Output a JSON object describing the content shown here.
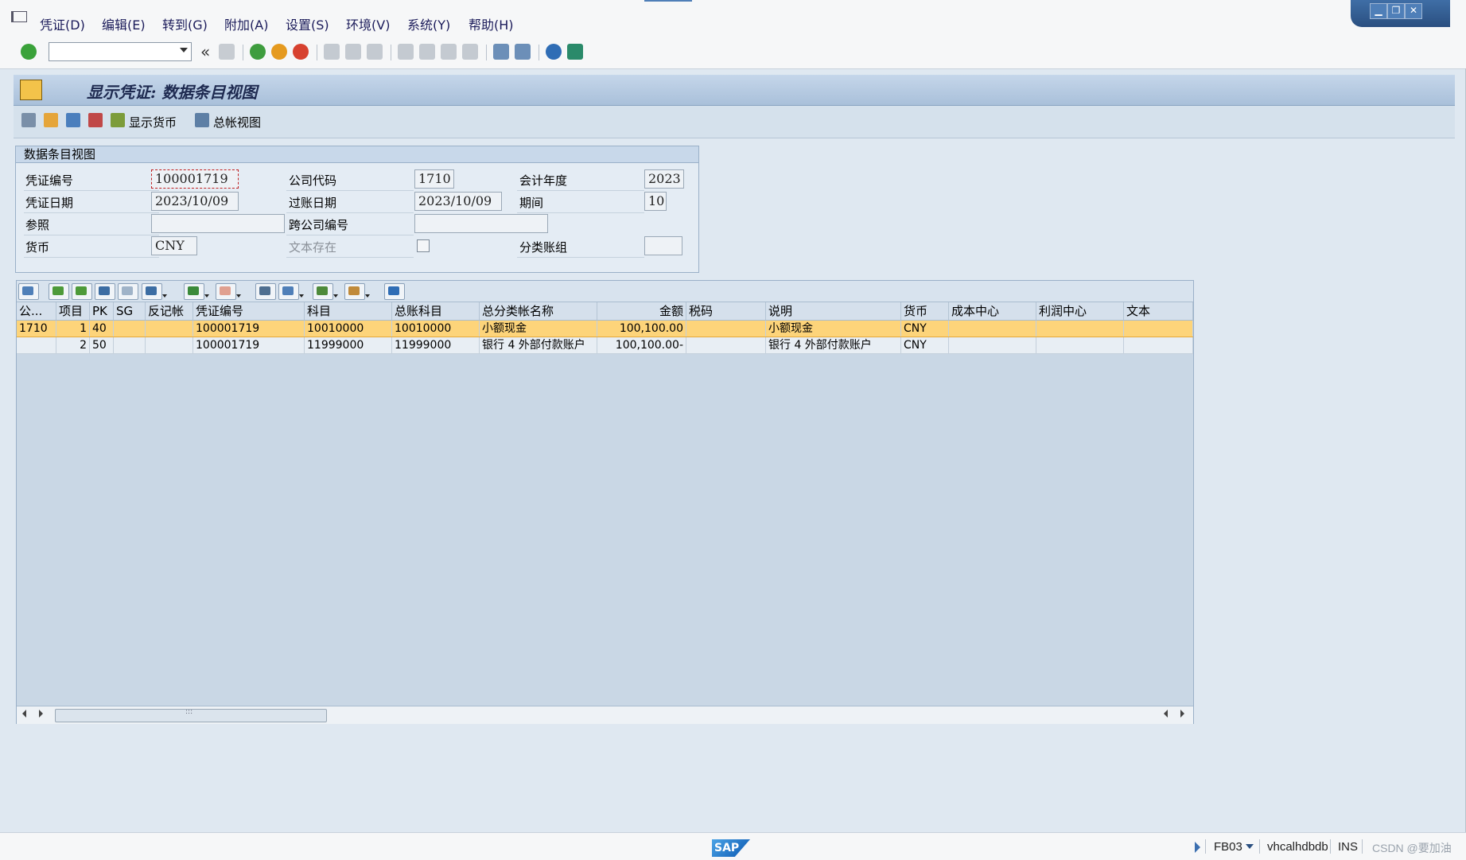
{
  "menu": [
    "凭证(D)",
    "编辑(E)",
    "转到(G)",
    "附加(A)",
    "设置(S)",
    "环境(V)",
    "系统(Y)",
    "帮助(H)"
  ],
  "toolbar": {
    "back_label": "«"
  },
  "window_controls": {
    "minimize": "▁",
    "restore": "❐",
    "close": "✕"
  },
  "title": "显示凭证: 数据条目视图",
  "app_toolbar": {
    "show_currency": "显示货币",
    "gl_view": "总帐视图"
  },
  "header": {
    "group_title": "数据条目视图",
    "doc_number_label": "凭证编号",
    "doc_number": "100001719",
    "company_code_label": "公司代码",
    "company_code": "1710",
    "fiscal_year_label": "会计年度",
    "fiscal_year": "2023",
    "doc_date_label": "凭证日期",
    "doc_date": "2023/10/09",
    "posting_date_label": "过账日期",
    "posting_date": "2023/10/09",
    "period_label": "期间",
    "period": "10",
    "reference_label": "参照",
    "reference": "",
    "intercompany_label": "跨公司编号",
    "intercompany": "",
    "currency_label": "货币",
    "currency": "CNY",
    "text_exists_label": "文本存在",
    "ledger_group_label": "分类账组",
    "ledger_group": ""
  },
  "grid": {
    "columns": [
      "公...",
      "项目",
      "PK",
      "SG",
      "反记帐",
      "凭证编号",
      "科目",
      "总账科目",
      "总分类帐名称",
      "金额",
      "税码",
      "说明",
      "货币",
      "成本中心",
      "利润中心",
      "文本"
    ],
    "rows": [
      [
        "1710",
        "1",
        "40",
        "",
        "",
        "100001719",
        "10010000",
        "10010000",
        "小额现金",
        "100,100.00",
        "",
        "小额现金",
        "CNY",
        "",
        "",
        ""
      ],
      [
        "",
        "2",
        "50",
        "",
        "",
        "100001719",
        "11999000",
        "11999000",
        "银行 4 外部付款账户",
        "100,100.00-",
        "",
        "银行 4 外部付款账户",
        "CNY",
        "",
        "",
        ""
      ]
    ],
    "scroll_grip": ":::"
  },
  "status": {
    "sap_logo": "SAP",
    "transaction": "FB03",
    "server": "vhcalhdbdb",
    "mode": "INS",
    "watermark": "CSDN @要加油"
  },
  "colors": {
    "selected_row": "#fdd47a",
    "title_bar": "#b7cbe2",
    "accent": "#2a4f80"
  }
}
